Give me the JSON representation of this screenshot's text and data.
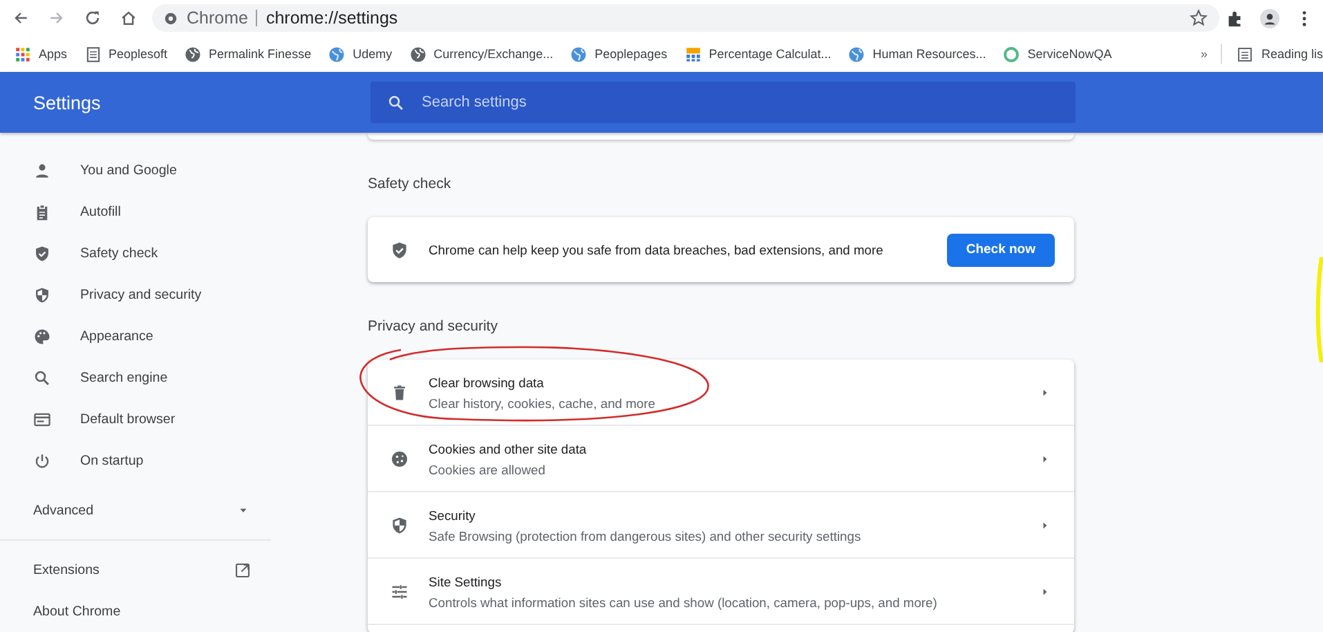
{
  "browser": {
    "site": "Chrome",
    "url": "chrome://settings"
  },
  "bookmarks": [
    {
      "kind": "apps",
      "label": "Apps"
    },
    {
      "kind": "page",
      "label": "Peoplesoft"
    },
    {
      "kind": "globe",
      "label": "Permalink Finesse"
    },
    {
      "kind": "web",
      "label": "Udemy"
    },
    {
      "kind": "globe",
      "label": "Currency/Exchange..."
    },
    {
      "kind": "web",
      "label": "Peoplepages"
    },
    {
      "kind": "calc",
      "label": "Percentage Calculat..."
    },
    {
      "kind": "web",
      "label": "Human Resources..."
    },
    {
      "kind": "ring",
      "label": "ServiceNowQA"
    }
  ],
  "bookmarks_overflow": "»",
  "reading_list": "Reading lis",
  "header": {
    "title": "Settings",
    "search_placeholder": "Search settings"
  },
  "sidebar": {
    "items": [
      {
        "kind": "person",
        "label": "You and Google"
      },
      {
        "kind": "clipboard",
        "label": "Autofill"
      },
      {
        "kind": "shieldcheck",
        "label": "Safety check"
      },
      {
        "kind": "shield",
        "label": "Privacy and security"
      },
      {
        "kind": "palette",
        "label": "Appearance"
      },
      {
        "kind": "search",
        "label": "Search engine"
      },
      {
        "kind": "browser",
        "label": "Default browser"
      },
      {
        "kind": "power",
        "label": "On startup"
      }
    ],
    "advanced": {
      "label": "Advanced",
      "expanded": false
    },
    "links": [
      {
        "label": "Extensions",
        "external": true
      },
      {
        "label": "About Chrome",
        "external": false
      }
    ]
  },
  "sections": [
    {
      "kind": "safety",
      "title": "Safety check",
      "text": "Chrome can help keep you safe from data breaches, bad extensions, and more",
      "button": "Check now"
    },
    {
      "kind": "list",
      "title": "Privacy and security",
      "rows": [
        {
          "kind": "trash",
          "title": "Clear browsing data",
          "subtitle": "Clear history, cookies, cache, and more"
        },
        {
          "kind": "cookie",
          "title": "Cookies and other site data",
          "subtitle": "Cookies are allowed"
        },
        {
          "kind": "shield",
          "title": "Security",
          "subtitle": "Safe Browsing (protection from dangerous sites) and other security settings"
        },
        {
          "kind": "sliders",
          "title": "Site Settings",
          "subtitle": "Controls what information sites can use and show (location, camera, pop-ups, and more)"
        }
      ]
    }
  ]
}
